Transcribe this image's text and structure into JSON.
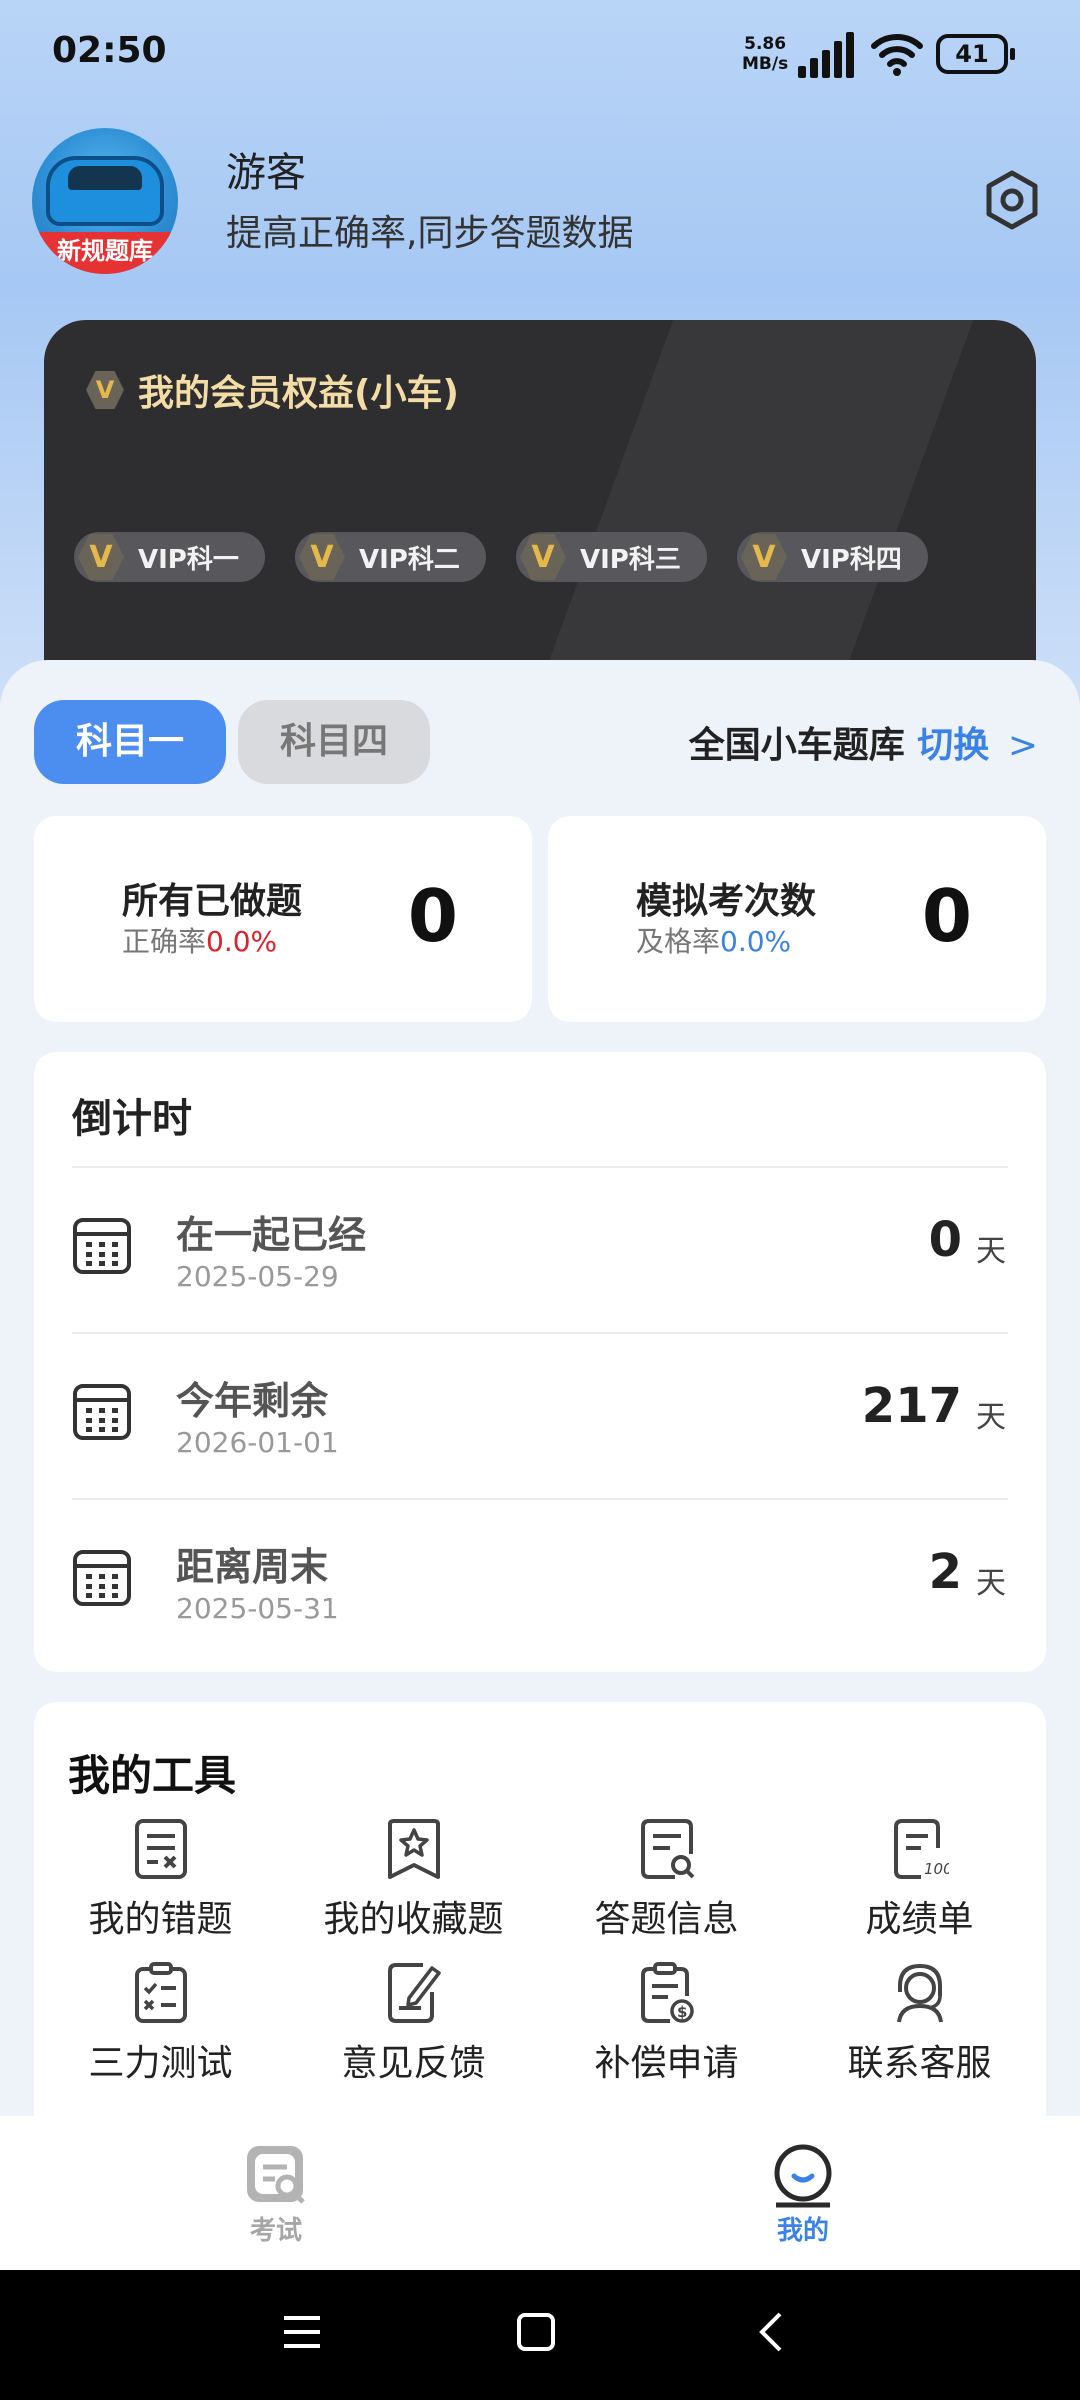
{
  "status_bar": {
    "time": "02:50",
    "net_speed": "5.86",
    "net_unit": "MB/s",
    "battery": "41"
  },
  "profile": {
    "avatar_ribbon": "新规题库",
    "name": "游客",
    "subtitle": "提高正确率,同步答题数据"
  },
  "vip_card": {
    "title": "我的会员权益(小车)",
    "badge_letter": "V",
    "chips": [
      "VIP科一",
      "VIP科二",
      "VIP科三",
      "VIP科四"
    ]
  },
  "subject_tabs": [
    {
      "label": "科目一",
      "active": true
    },
    {
      "label": "科目四",
      "active": false
    }
  ],
  "question_bank": {
    "label": "全国小车题库",
    "switch_label": "切换",
    "chevron": ">"
  },
  "stats": [
    {
      "label": "所有已做题",
      "sub_label": "正确率",
      "sub_value": "0.0%",
      "value": "0"
    },
    {
      "label": "模拟考次数",
      "sub_label": "及格率",
      "sub_value": "0.0%",
      "value": "0"
    }
  ],
  "countdown": {
    "title": "倒计时",
    "items": [
      {
        "name": "在一起已经",
        "date": "2025-05-29",
        "value": "0",
        "unit": "天"
      },
      {
        "name": "今年剩余",
        "date": "2026-01-01",
        "value": "217",
        "unit": "天"
      },
      {
        "name": "距离周末",
        "date": "2025-05-31",
        "value": "2",
        "unit": "天"
      }
    ]
  },
  "tools": {
    "title": "我的工具",
    "items": [
      {
        "label": "我的错题",
        "icon": "wrong-questions-icon"
      },
      {
        "label": "我的收藏题",
        "icon": "favorite-questions-icon"
      },
      {
        "label": "答题信息",
        "icon": "answer-info-icon"
      },
      {
        "label": "成绩单",
        "icon": "score-report-icon"
      },
      {
        "label": "三力测试",
        "icon": "checklist-icon"
      },
      {
        "label": "意见反馈",
        "icon": "feedback-icon"
      },
      {
        "label": "补偿申请",
        "icon": "compensation-icon"
      },
      {
        "label": "联系客服",
        "icon": "customer-service-icon"
      }
    ]
  },
  "bottom_nav": [
    {
      "label": "考试",
      "active": false
    },
    {
      "label": "我的",
      "active": true
    }
  ],
  "colors": {
    "accent": "#3a82e6",
    "red": "#e0202a",
    "vip_gold": "#f4dca6",
    "vip_bg": "#2e2e30"
  }
}
